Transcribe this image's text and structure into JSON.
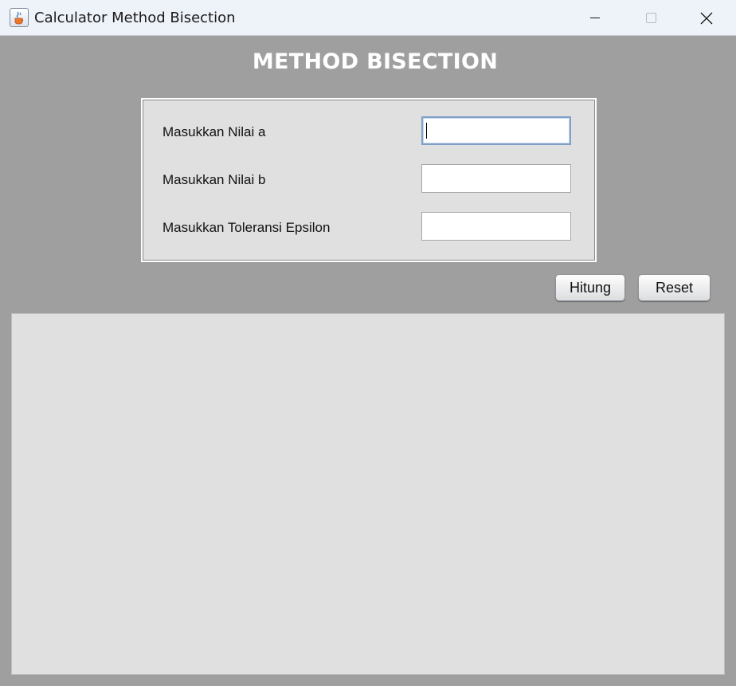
{
  "window": {
    "title": "Calculator Method Bisection",
    "icon": "java-cup-icon"
  },
  "heading": "METHOD BISECTION",
  "form": {
    "label_a": "Masukkan Nilai a",
    "value_a": "",
    "label_b": "Masukkan Nilai b",
    "value_b": "",
    "label_epsilon": "Masukkan Toleransi Epsilon",
    "value_epsilon": ""
  },
  "buttons": {
    "hitung": "Hitung",
    "reset": "Reset"
  },
  "output": {
    "text": ""
  },
  "colors": {
    "background": "#9f9f9f",
    "panel": "#e0e0e0",
    "heading": "#ffffff",
    "focus_border": "#7fa0c8"
  }
}
